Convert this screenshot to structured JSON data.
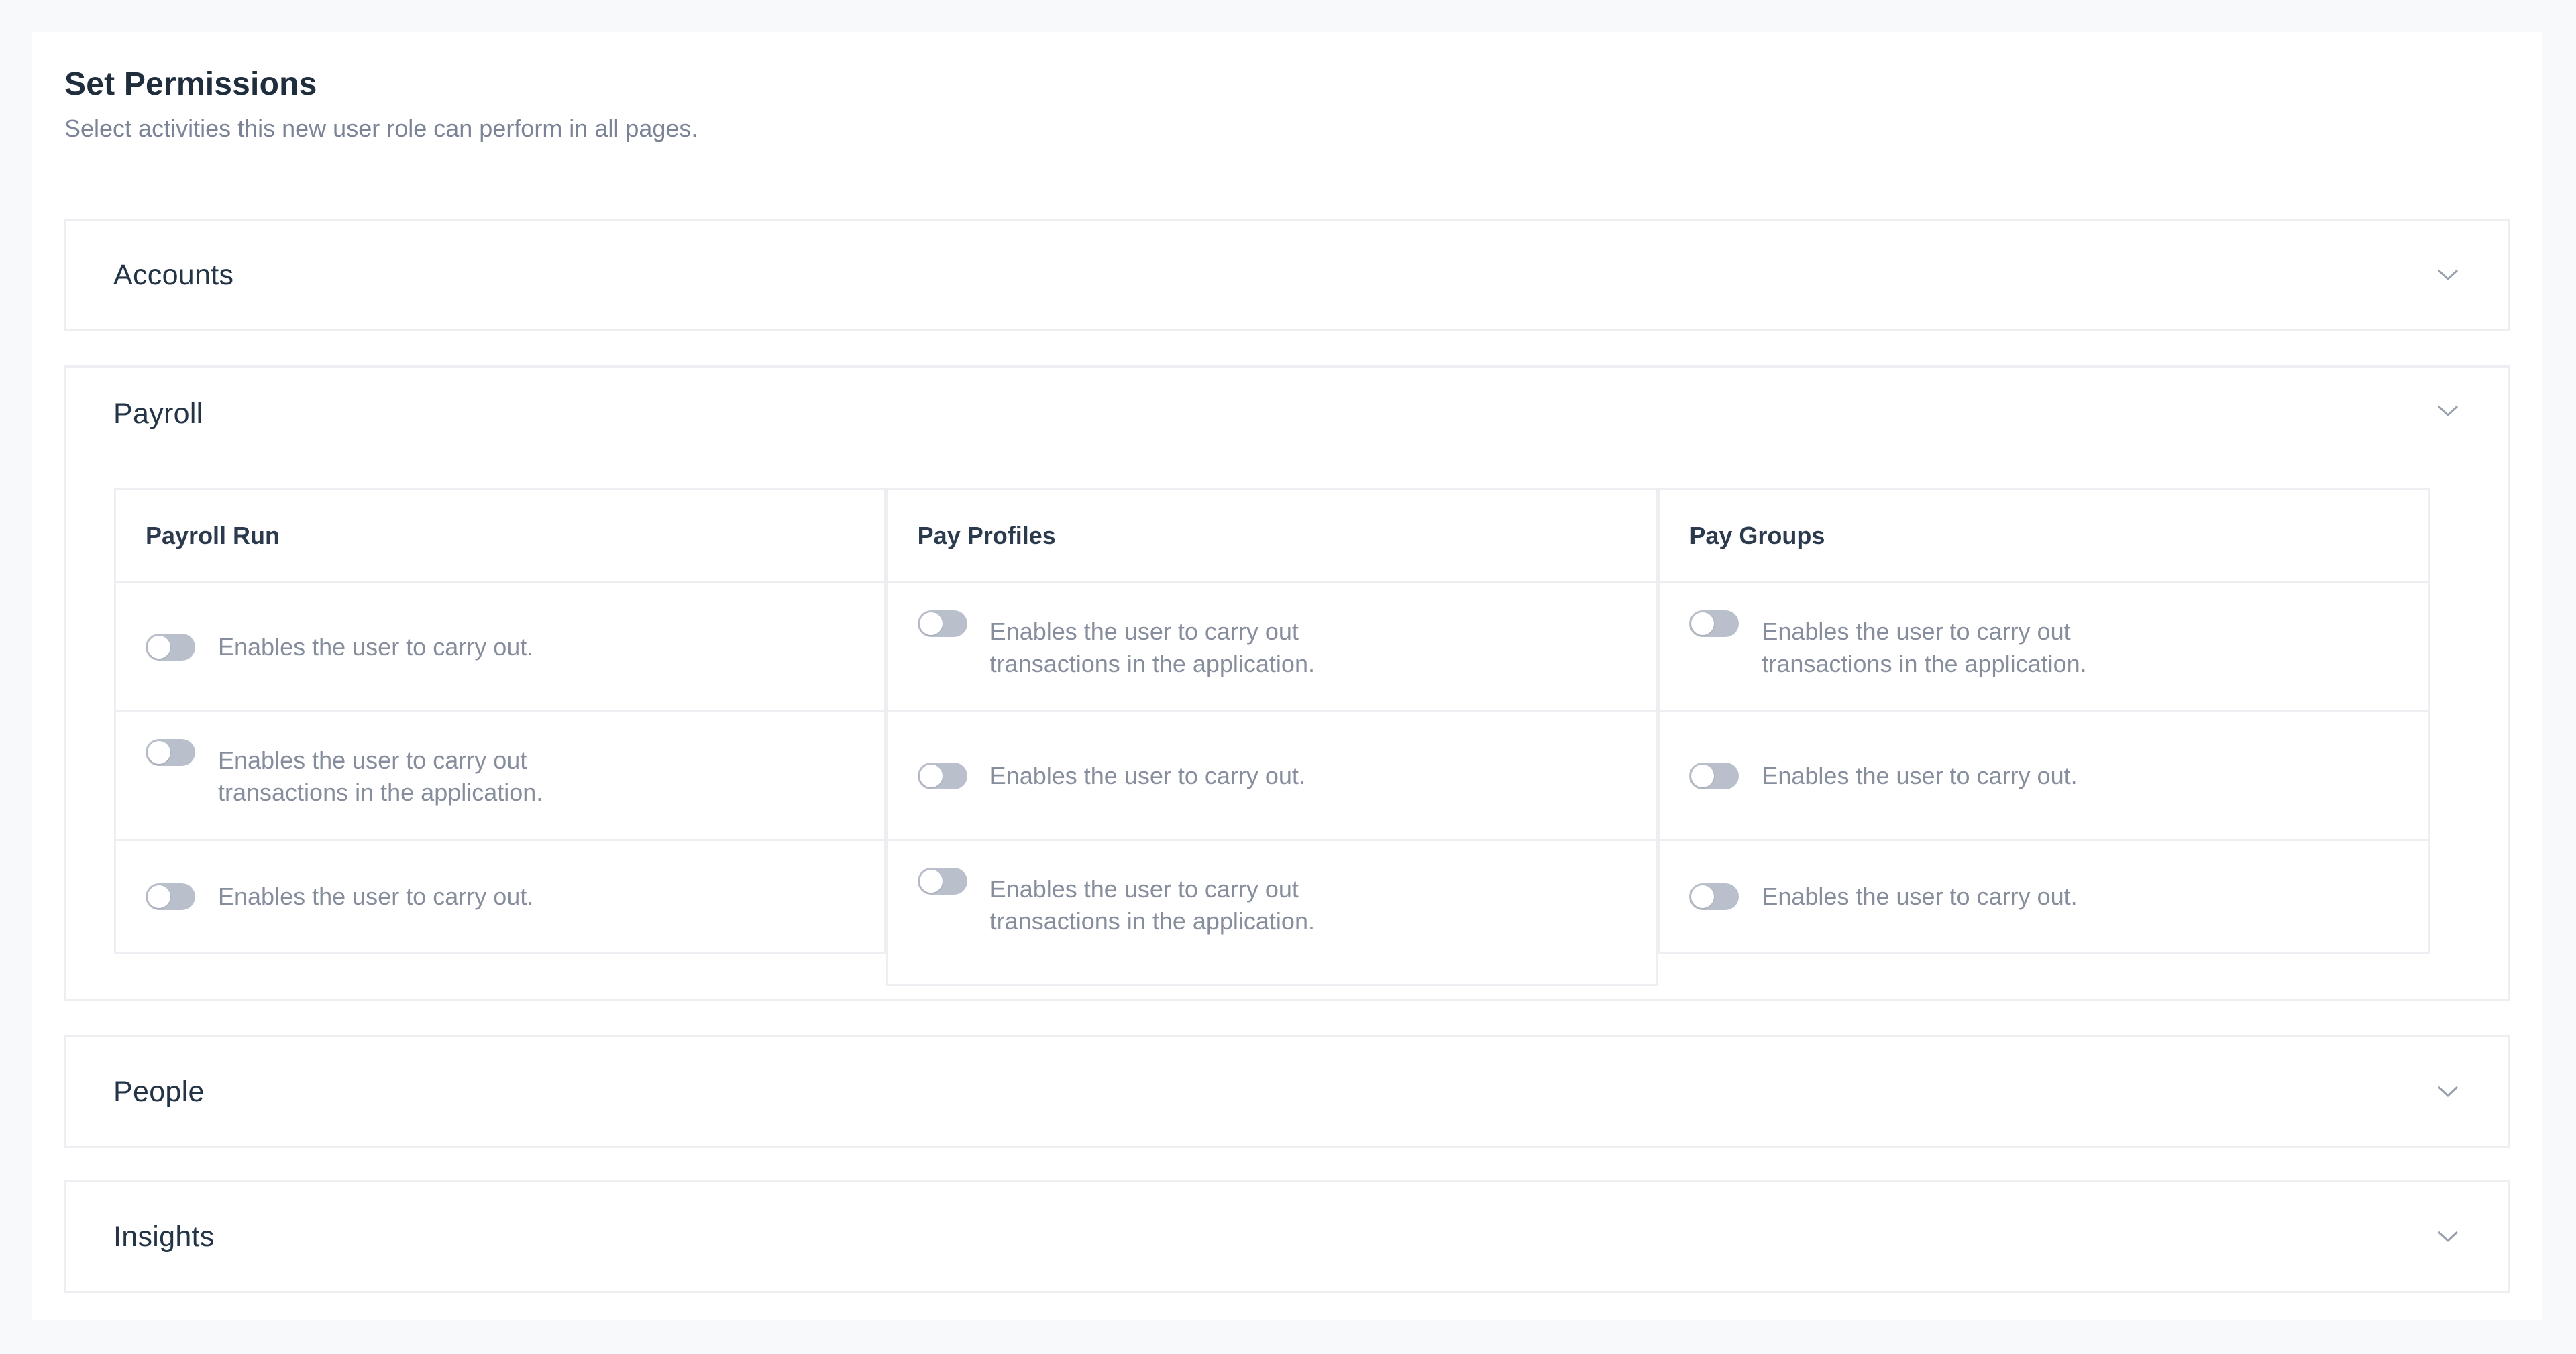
{
  "header": {
    "title": "Set Permissions",
    "subtitle": "Select activities this new user role can perform in all pages."
  },
  "sections": [
    {
      "title": "Accounts",
      "expanded": false,
      "icon": "chevron-down-icon"
    },
    {
      "title": "Payroll",
      "expanded": true,
      "icon": "chevron-down-icon"
    },
    {
      "title": "People",
      "expanded": false,
      "icon": "chevron-down-icon"
    },
    {
      "title": "Insights",
      "expanded": false,
      "icon": "chevron-down-icon"
    }
  ],
  "payroll": {
    "columns": [
      {
        "heading": "Payroll Run",
        "permissions": [
          {
            "label": "Enables the user to carry out.",
            "enabled": false
          },
          {
            "label": "Enables the user to carry out transactions in the application.",
            "enabled": false
          },
          {
            "label": "Enables the user to carry out.",
            "enabled": false
          }
        ]
      },
      {
        "heading": "Pay Profiles",
        "permissions": [
          {
            "label": "Enables the user to carry out transactions in the application.",
            "enabled": false
          },
          {
            "label": "Enables the user to carry out.",
            "enabled": false
          },
          {
            "label": "Enables the user to carry out transactions in the application.",
            "enabled": false
          }
        ]
      },
      {
        "heading": "Pay Groups",
        "permissions": [
          {
            "label": "Enables the user to carry out transactions in the application.",
            "enabled": false
          },
          {
            "label": "Enables the user to carry out.",
            "enabled": false
          },
          {
            "label": "Enables the user to carry out.",
            "enabled": false
          }
        ]
      }
    ]
  },
  "colors": {
    "text_primary": "#1f2d3d",
    "text_muted": "#868d9c",
    "border": "#eceef2",
    "toggle_off": "#b9bfcb",
    "page_background": "#f8f9fb"
  }
}
